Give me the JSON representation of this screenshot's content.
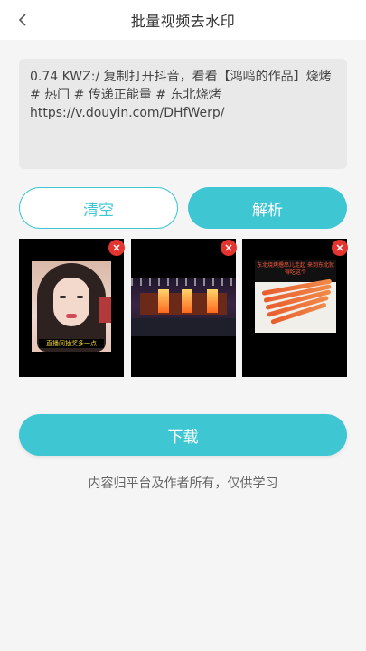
{
  "header": {
    "title": "批量视频去水印",
    "back_icon": "chevron-left-icon"
  },
  "input": {
    "value": "0.74 KWZ:/ 复制打开抖音，看看【鸿鸣的作品】烧烤 # 热门 # 传递正能量 # 东北烧烤\nhttps://v.douyin.com/DHfWerp/"
  },
  "buttons": {
    "clear_label": "清空",
    "parse_label": "解析",
    "download_label": "下载"
  },
  "thumbnails": [
    {
      "caption": "直播间抽奖多一点",
      "remove_icon": "close-icon"
    },
    {
      "remove_icon": "close-icon"
    },
    {
      "banner": "东北烧烤撸串儿走起 来到东北就得吃这个",
      "remove_icon": "close-icon"
    }
  ],
  "footer": {
    "note": "内容归平台及作者所有，仅供学习"
  },
  "colors": {
    "accent": "#3ec6d3",
    "remove": "#e3342f",
    "background": "#f5f5f5"
  }
}
